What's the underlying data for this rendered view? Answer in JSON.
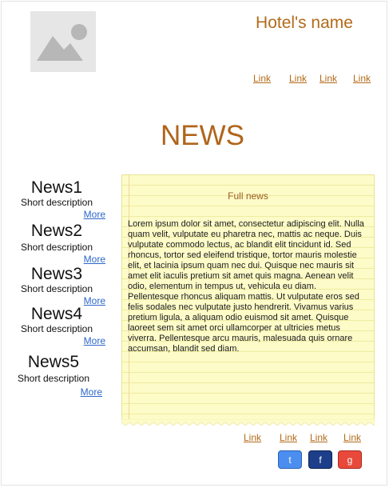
{
  "header": {
    "hotel_name": "Hotel's name",
    "nav": [
      "Link",
      "Link",
      "Link",
      "Link"
    ]
  },
  "page_title": "NEWS",
  "news_list": [
    {
      "title": "News1",
      "description": "Short description",
      "more": "More"
    },
    {
      "title": "News2",
      "description": "Short description",
      "more": "More"
    },
    {
      "title": "News3",
      "description": "Short description",
      "more": "More"
    },
    {
      "title": "News4",
      "description": "Short description",
      "more": "More"
    },
    {
      "title": "News5",
      "description": "Short description",
      "more": "More"
    }
  ],
  "full_news": {
    "title": "Full news",
    "body": "Lorem ipsum dolor sit amet, consectetur adipiscing elit. Nulla quam velit, vulputate eu pharetra nec, mattis ac neque. Duis vulputate commodo lectus, ac blandit elit tincidunt id. Sed rhoncus, tortor sed eleifend tristique, tortor mauris molestie elit, et lacinia ipsum quam nec dui. Quisque nec mauris sit amet elit iaculis pretium sit amet quis magna. Aenean velit odio, elementum in tempus ut, vehicula eu diam. Pellentesque rhoncus aliquam mattis. Ut vulputate eros sed felis sodales nec vulputate justo hendrerit. Vivamus varius pretium ligula, a aliquam odio euismod sit amet. Quisque laoreet sem sit amet orci ullamcorper at ultricies metus viverra. Pellentesque arcu mauris, malesuada quis ornare accumsan, blandit sed diam."
  },
  "footer": {
    "nav": [
      "Link",
      "Link",
      "Link",
      "Link"
    ],
    "social": [
      {
        "label": "t",
        "icon": "twitter-icon",
        "color": "#4b8ef0"
      },
      {
        "label": "f",
        "icon": "facebook-icon",
        "color": "#1d3e8a"
      },
      {
        "label": "g",
        "icon": "google-plus-icon",
        "color": "#e8493a"
      }
    ]
  },
  "colors": {
    "accent": "#b26b1a",
    "link_blue": "#2d67c9",
    "note_bg": "#fdfbc8"
  }
}
